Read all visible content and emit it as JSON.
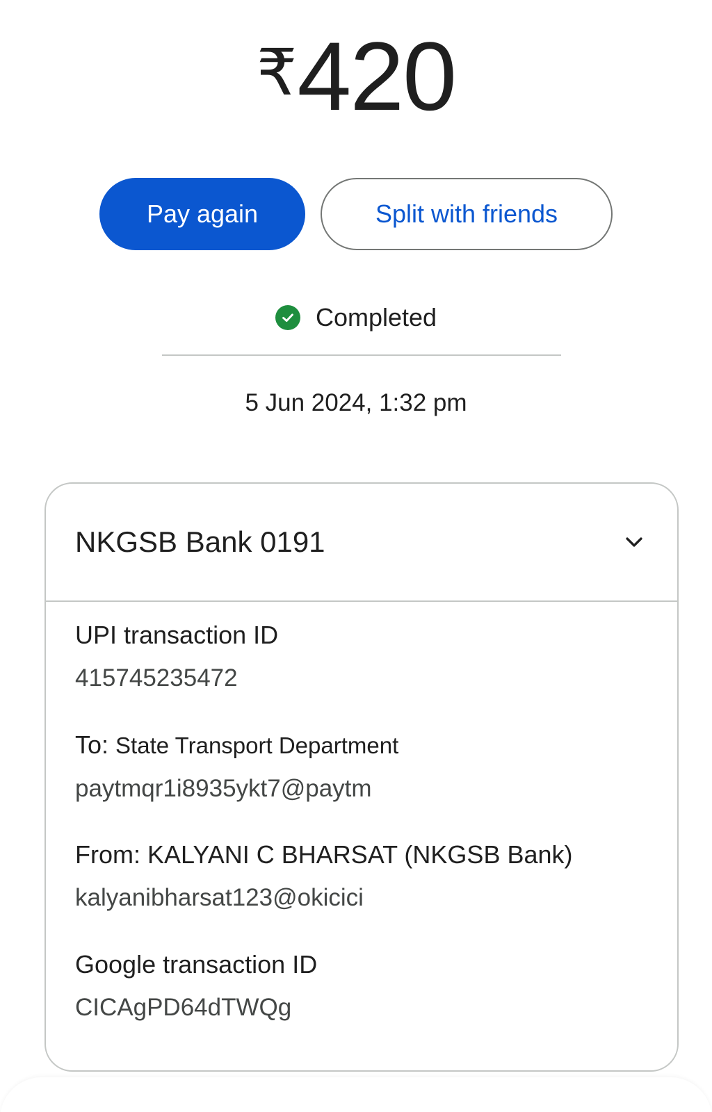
{
  "transaction": {
    "currency_symbol": "₹",
    "amount": "420",
    "status": "Completed",
    "datetime": "5 Jun 2024, 1:32 pm"
  },
  "actions": {
    "pay_again": "Pay again",
    "split": "Split with friends"
  },
  "account": {
    "bank_label": "NKGSB Bank 0191"
  },
  "details": {
    "upi_label": "UPI transaction ID",
    "upi_value": "415745235472",
    "to_prefix": "To:",
    "to_name": "State Transport Department",
    "to_value": "paytmqr1i8935ykt7@paytm",
    "from_label": "From: KALYANI C BHARSAT (NKGSB Bank)",
    "from_value": "kalyanibharsat123@okicici",
    "google_label": "Google transaction ID",
    "google_value": "CICAgPD64dTWQg"
  },
  "colors": {
    "primary": "#0b57d0",
    "success": "#1e8e3e",
    "border": "#c4c7c5"
  },
  "icons": {
    "status": "check-circle-icon",
    "expand": "chevron-down-icon"
  }
}
